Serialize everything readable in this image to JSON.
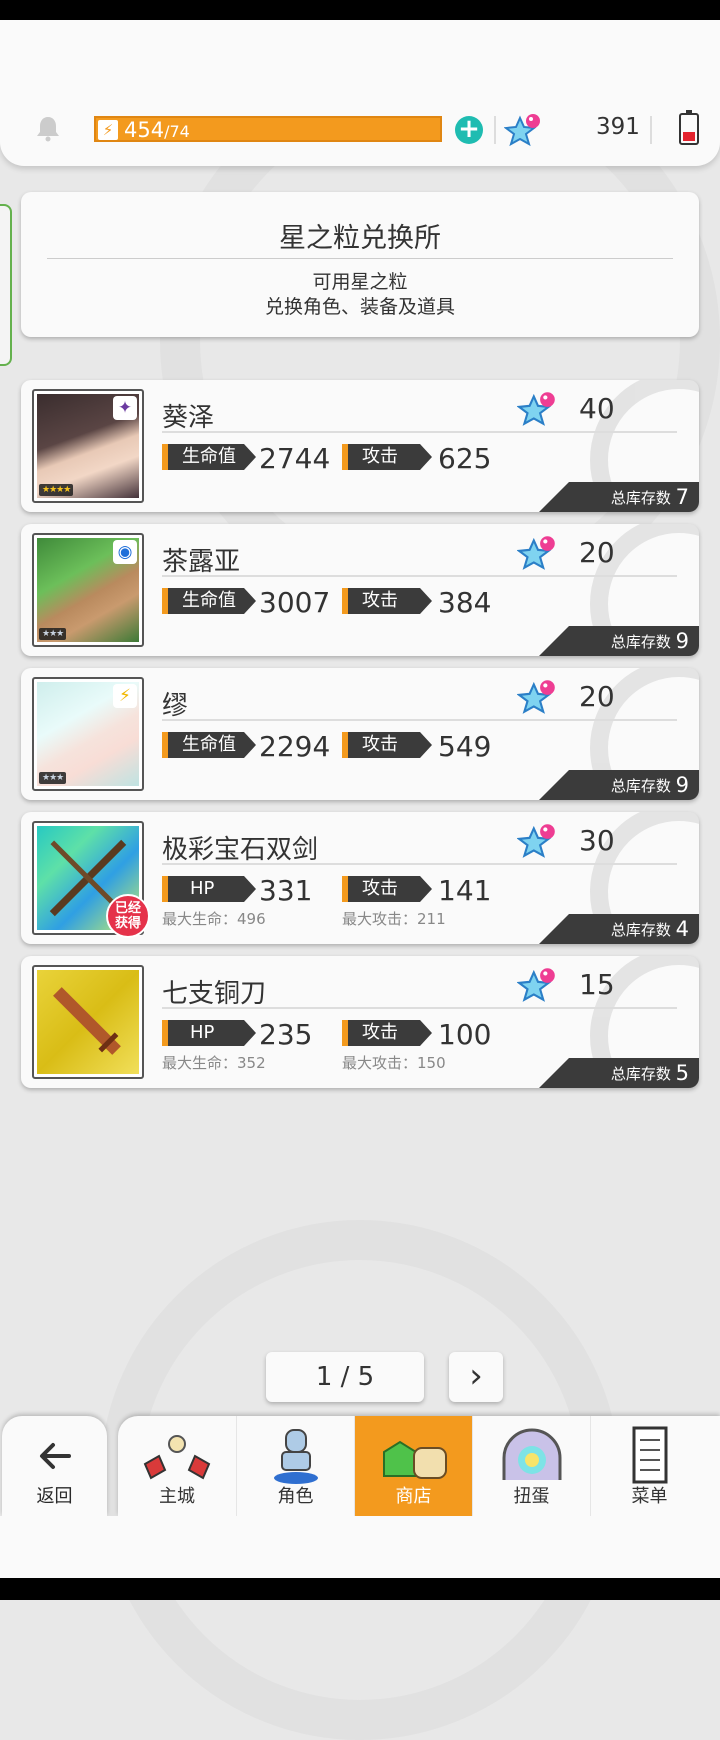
{
  "status_bar": {
    "energy_current": "454",
    "energy_max": "/74",
    "star_gems": "391"
  },
  "header": {
    "title": "星之粒兑换所",
    "subtitle_line1": "可用星之粒",
    "subtitle_line2": "兑换角色、装备及道具"
  },
  "items": [
    {
      "name": "葵泽",
      "price": "40",
      "stat1_label": "生命值",
      "stat1_value": "2744",
      "stat2_label": "攻击",
      "stat2_value": "625",
      "stock_label": "总库存数",
      "stock_value": "7",
      "rarity": "★★★★",
      "element_icon": "dark-element-icon"
    },
    {
      "name": "茶露亚",
      "price": "20",
      "stat1_label": "生命值",
      "stat1_value": "3007",
      "stat2_label": "攻击",
      "stat2_value": "384",
      "stock_label": "总库存数",
      "stock_value": "9",
      "rarity": "★★★",
      "element_icon": "water-element-icon"
    },
    {
      "name": "缪",
      "price": "20",
      "stat1_label": "生命值",
      "stat1_value": "2294",
      "stat2_label": "攻击",
      "stat2_value": "549",
      "stock_label": "总库存数",
      "stock_value": "9",
      "rarity": "★★★",
      "element_icon": "lightning-element-icon"
    },
    {
      "name": "极彩宝石双剑",
      "price": "30",
      "stat1_label": "HP",
      "stat1_value": "331",
      "stat2_label": "攻击",
      "stat2_value": "141",
      "max1": "最大生命：496",
      "max2": "最大攻击：211",
      "stock_label": "总库存数",
      "stock_value": "4",
      "obtained_line1": "已经",
      "obtained_line2": "获得"
    },
    {
      "name": "七支铜刀",
      "price": "15",
      "stat1_label": "HP",
      "stat1_value": "235",
      "stat2_label": "攻击",
      "stat2_value": "100",
      "max1": "最大生命：352",
      "max2": "最大攻击：150",
      "stock_label": "总库存数",
      "stock_value": "5"
    }
  ],
  "pager": {
    "text": "1 / 5",
    "next": "›"
  },
  "nav": {
    "back": "返回",
    "tabs": [
      "主城",
      "角色",
      "商店",
      "扭蛋",
      "菜单"
    ]
  },
  "colors": {
    "accent": "#f39a1e",
    "dark": "#3b3b3b",
    "teal": "#1fbcb1",
    "badge_red": "#e5324a"
  }
}
